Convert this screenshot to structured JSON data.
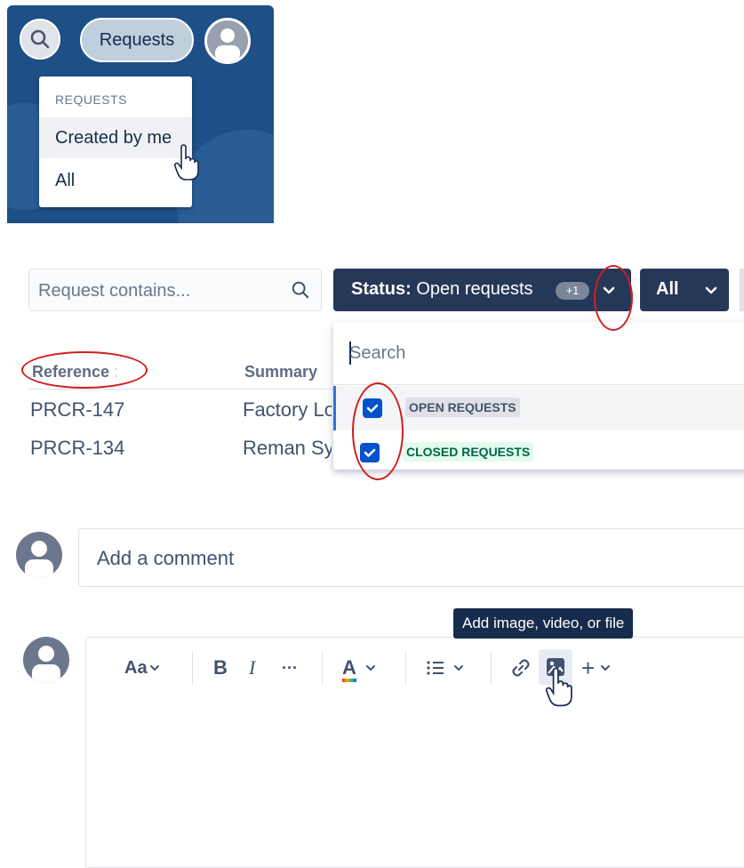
{
  "nav": {
    "requests_button": "Requests",
    "menu": {
      "header": "REQUESTS",
      "items": [
        "Created by me",
        "All"
      ]
    }
  },
  "filters": {
    "search_placeholder": "Request contains...",
    "status_prefix": "Status:",
    "status_value": "Open requests",
    "status_badge": "+1",
    "all_label": "All"
  },
  "table": {
    "headers": [
      "Reference",
      "Summary"
    ],
    "reference_sort_indicator": ":",
    "rows": [
      {
        "reference": "PRCR-147",
        "summary": "Factory Lo"
      },
      {
        "reference": "PRCR-134",
        "summary": "Reman Sy"
      }
    ]
  },
  "status_dropdown": {
    "search_placeholder": "Search",
    "options": [
      {
        "label": "OPEN REQUESTS",
        "checked": true
      },
      {
        "label": "CLOSED REQUESTS",
        "checked": true
      }
    ]
  },
  "comment": {
    "placeholder": "Add a comment"
  },
  "editor": {
    "tooltip": "Add image, video, or file",
    "toolbar": {
      "font": "Aa",
      "bold": "B",
      "italic": "I",
      "more": "···",
      "color": "A",
      "insert": "+"
    }
  },
  "colors": {
    "nav_background": "#1e4f86",
    "filter_button": "#253858",
    "checkbox": "#0052cc",
    "annotation": "#d11f1f",
    "closed_lozenge_text": "#006644"
  }
}
